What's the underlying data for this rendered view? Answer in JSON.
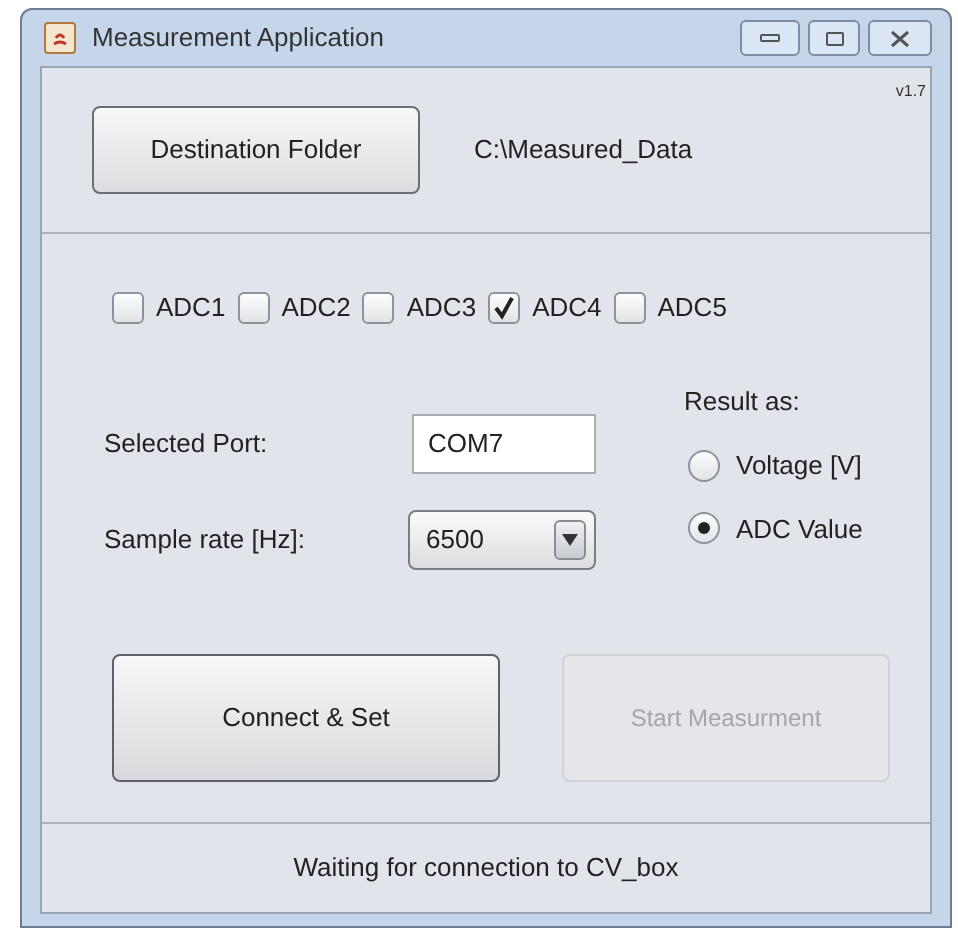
{
  "window": {
    "title": "Measurement Application",
    "version": "v1.7"
  },
  "destination": {
    "button": "Destination Folder",
    "path": "C:\\Measured_Data"
  },
  "channels": [
    {
      "label": "ADC1",
      "checked": false
    },
    {
      "label": "ADC2",
      "checked": false
    },
    {
      "label": "ADC3",
      "checked": false
    },
    {
      "label": "ADC4",
      "checked": true
    },
    {
      "label": "ADC5",
      "checked": false
    }
  ],
  "port": {
    "label": "Selected Port:",
    "value": "COM7"
  },
  "sample_rate": {
    "label": "Sample rate [Hz]:",
    "value": "6500"
  },
  "result": {
    "label": "Result as:",
    "options": [
      {
        "label": "Voltage [V]",
        "selected": false
      },
      {
        "label": "ADC Value",
        "selected": true
      }
    ]
  },
  "buttons": [
    {
      "label": "Connect & Set",
      "disabled": false
    },
    {
      "label": "Start Measurment",
      "disabled": true
    }
  ],
  "status_bar": "Waiting for connection to CV_box"
}
